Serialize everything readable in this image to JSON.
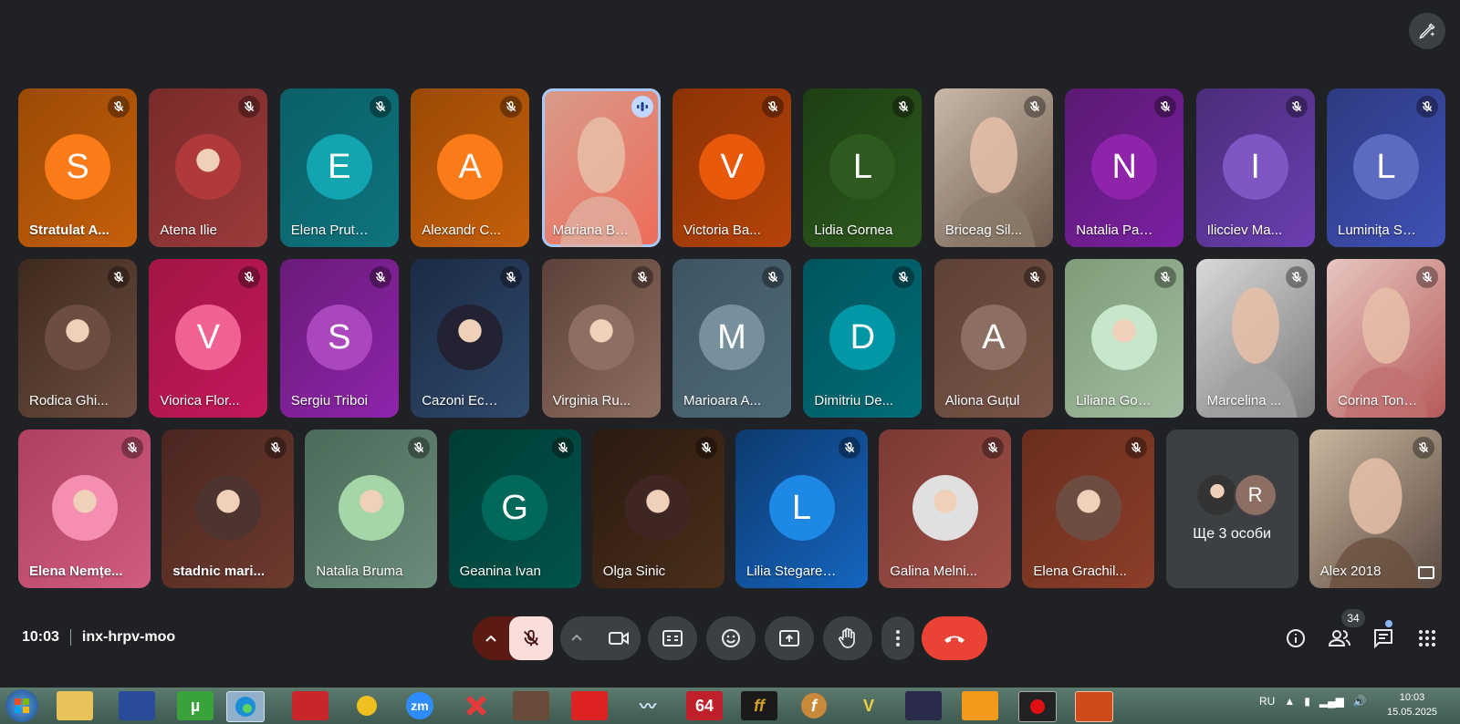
{
  "tiles": [
    {
      "name": "Stratulat A...",
      "initial": "S",
      "avatar_color": "#fa7b17",
      "bg": "linear-gradient(135deg,#9a4a05,#c65f0a)",
      "bold": true,
      "type": "initial"
    },
    {
      "name": "Atena Ilie",
      "initial": "",
      "avatar_color": "#b03a3a",
      "bg": "linear-gradient(135deg,#7a2a2a,#9a3b3b)",
      "type": "photo-avatar"
    },
    {
      "name": "Elena Prute...",
      "initial": "E",
      "avatar_color": "#12a4af",
      "bg": "linear-gradient(135deg,#0b5f68,#0e747d)",
      "type": "initial"
    },
    {
      "name": "Alexandr C...",
      "initial": "A",
      "avatar_color": "#fa7b17",
      "bg": "linear-gradient(135deg,#9a4a05,#c65f0a)",
      "type": "initial"
    },
    {
      "name": "Mariana Ba...",
      "initial": "",
      "avatar_color": "#e0b0a0",
      "bg": "linear-gradient(135deg,#d89c8a,#ef6b5a)",
      "type": "video",
      "speaking": true
    },
    {
      "name": "Victoria Ba...",
      "initial": "V",
      "avatar_color": "#e8590c",
      "bg": "linear-gradient(135deg,#8c3304,#b5430a)",
      "type": "initial"
    },
    {
      "name": "Lidia Gornea",
      "initial": "L",
      "avatar_color": "#2d5a1e",
      "bg": "linear-gradient(135deg,#1e3f13,#2d5a1e)",
      "type": "initial"
    },
    {
      "name": "Briceag Sil...",
      "initial": "",
      "avatar_color": "#8a7a6a",
      "bg": "linear-gradient(135deg,#c9b9a8,#6b5a4d)",
      "type": "video"
    },
    {
      "name": "Natalia Pan...",
      "initial": "N",
      "avatar_color": "#8e24aa",
      "bg": "linear-gradient(135deg,#5a1a72,#7b1fa2)",
      "type": "initial"
    },
    {
      "name": "Ilicciev Ma...",
      "initial": "I",
      "avatar_color": "#7e57c2",
      "bg": "linear-gradient(135deg,#4a2d7a,#6a3fb0)",
      "type": "initial"
    },
    {
      "name": "Luminița Se...",
      "initial": "L",
      "avatar_color": "#5c6bc0",
      "bg": "linear-gradient(135deg,#2e3a80,#3f51b5)",
      "type": "initial"
    },
    {
      "name": "Rodica Ghi...",
      "initial": "",
      "avatar_color": "#6d4c41",
      "bg": "linear-gradient(135deg,#3e2a1e,#6d4c41)",
      "type": "photo-avatar"
    },
    {
      "name": "Viorica Flor...",
      "initial": "V",
      "avatar_color": "#f06292",
      "bg": "linear-gradient(135deg,#a31545,#c2185b)",
      "type": "initial"
    },
    {
      "name": "Sergiu Triboi",
      "initial": "S",
      "avatar_color": "#ab47bc",
      "bg": "linear-gradient(135deg,#6a1b7a,#8e24aa)",
      "type": "initial"
    },
    {
      "name": "Cazoni Eca...",
      "initial": "",
      "avatar_color": "#223",
      "bg": "linear-gradient(135deg,#1c2a44,#2f4a6e)",
      "type": "photo-avatar"
    },
    {
      "name": "Virginia Ru...",
      "initial": "",
      "avatar_color": "#8d6e63",
      "bg": "linear-gradient(135deg,#5d4037,#8d6e63)",
      "type": "photo-avatar"
    },
    {
      "name": "Marioara A...",
      "initial": "M",
      "avatar_color": "#78909c",
      "bg": "linear-gradient(135deg,#3e5560,#4f6b78)",
      "type": "initial"
    },
    {
      "name": "Dimitriu De...",
      "initial": "D",
      "avatar_color": "#0097a7",
      "bg": "linear-gradient(135deg,#00545d,#006d78)",
      "type": "initial"
    },
    {
      "name": "Aliona Guțul",
      "initial": "A",
      "avatar_color": "#8d6e63",
      "bg": "linear-gradient(135deg,#5d4037,#7a5548)",
      "type": "initial"
    },
    {
      "name": "Liliana God...",
      "initial": "",
      "avatar_color": "#c8e6c9",
      "bg": "linear-gradient(135deg,#7f9c7a,#a3bba0)",
      "type": "photo-avatar"
    },
    {
      "name": "Marcelina ...",
      "initial": "",
      "avatar_color": "#a0a0a0",
      "bg": "linear-gradient(135deg,#d9d9d9,#7a7a7a)",
      "type": "video"
    },
    {
      "name": "Corina Toni...",
      "initial": "",
      "avatar_color": "#c07070",
      "bg": "linear-gradient(135deg,#e8c6c0,#b55a5a)",
      "type": "video"
    },
    {
      "name": "Elena Nemțe...",
      "initial": "",
      "avatar_color": "#f48fb1",
      "bg": "linear-gradient(135deg,#b0405f,#d05c80)",
      "bold": true,
      "type": "photo-avatar"
    },
    {
      "name": "stadnic mari...",
      "initial": "",
      "avatar_color": "#4e342e",
      "bg": "linear-gradient(135deg,#4a2620,#6e3a2e)",
      "bold": true,
      "type": "photo-avatar"
    },
    {
      "name": "Natalia Bruma",
      "initial": "",
      "avatar_color": "#a5d6a7",
      "bg": "linear-gradient(135deg,#4b6b5a,#6b8c7a)",
      "type": "photo-avatar"
    },
    {
      "name": "Geanina Ivan",
      "initial": "G",
      "avatar_color": "#00695c",
      "bg": "linear-gradient(135deg,#003d36,#00544a)",
      "type": "initial"
    },
    {
      "name": "Olga Sinic",
      "initial": "",
      "avatar_color": "#3e2723",
      "bg": "linear-gradient(135deg,#2a1a10,#4a2f1c)",
      "type": "photo-avatar"
    },
    {
      "name": "Lilia Stegares...",
      "initial": "L",
      "avatar_color": "#1e88e5",
      "bg": "linear-gradient(135deg,#0d3a6e,#1565c0)",
      "type": "initial"
    },
    {
      "name": "Galina Melni...",
      "initial": "",
      "avatar_color": "#e0e0e0",
      "bg": "linear-gradient(135deg,#7a3a33,#a05048)",
      "type": "photo-avatar"
    },
    {
      "name": "Elena Grachil...",
      "initial": "",
      "avatar_color": "#6d4c41",
      "bg": "linear-gradient(135deg,#6a2e1e,#8c3e28)",
      "type": "photo-avatar"
    },
    {
      "name": "",
      "initial": "",
      "avatar_color": "",
      "bg": "#3c4043",
      "type": "more"
    },
    {
      "name": "Alex 2018",
      "initial": "",
      "avatar_color": "#6a5040",
      "bg": "linear-gradient(135deg,#c9b7a0,#5a4a40)",
      "type": "video"
    }
  ],
  "more": {
    "label": "Ще 3 особи",
    "second_initial": "R"
  },
  "meeting": {
    "time": "10:03",
    "code": "inx-hrpv-moo"
  },
  "people_count": "34",
  "taskbar": {
    "lang": "RU",
    "time": "10:03",
    "date": "15.05.2025",
    "apps": [
      "zm",
      "64",
      "ff",
      "f",
      "V"
    ]
  },
  "colors": {
    "end_call": "#ea4335",
    "mic_off_bg": "#f9dedc",
    "mic_group": "#5c1a14"
  }
}
